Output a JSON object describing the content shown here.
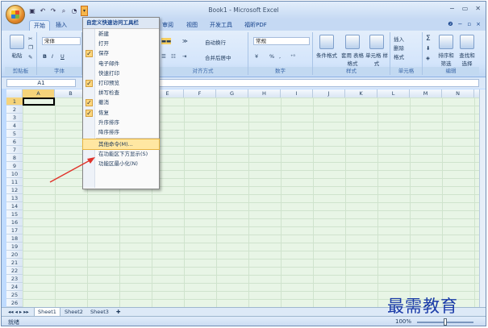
{
  "window": {
    "title": "Book1 - Microsoft Excel",
    "controls": [
      "−",
      "▭",
      "✕"
    ]
  },
  "ribbon": {
    "tabs": [
      "开始",
      "插入",
      "审阅",
      "视图",
      "开发工具",
      "福昕PDF"
    ],
    "active_tab": "开始",
    "font": {
      "name": "宋体",
      "bold": "B",
      "italic": "I",
      "underline": "U"
    },
    "alignment": {
      "wrap": "自动换行",
      "merge": "合并后居中",
      "label": "对齐方式"
    },
    "number": {
      "format": "常规",
      "percent": "%",
      "comma": ",",
      "label": "数字"
    },
    "styles": {
      "conditional": "条件格式",
      "table": "套用\n表格格式",
      "cell": "单元格\n样式",
      "label": "样式"
    },
    "cells": {
      "insert": "插入",
      "delete": "删除",
      "format": "格式",
      "label": "单元格"
    },
    "editing": {
      "sum": "Σ",
      "sort": "排序和\n筛选",
      "find": "查找和\n选择",
      "label": "编辑"
    },
    "clipboard": {
      "paste": "粘贴",
      "label": "剪贴板"
    },
    "font_group_label": "字体"
  },
  "formula_bar": {
    "name_box": "A1",
    "value": ""
  },
  "grid": {
    "columns": [
      "A",
      "B",
      "C",
      "D",
      "E",
      "F",
      "G",
      "H",
      "I",
      "J",
      "K",
      "L",
      "M",
      "N"
    ],
    "rows": [
      "1",
      "2",
      "3",
      "4",
      "5",
      "6",
      "7",
      "8",
      "9",
      "10",
      "11",
      "12",
      "13",
      "14",
      "15",
      "16",
      "17",
      "18",
      "19",
      "20",
      "21",
      "22",
      "23",
      "24",
      "25",
      "26"
    ],
    "active_cell": "A1"
  },
  "qat_menu": {
    "title": "自定义快速访问工具栏",
    "items": [
      {
        "label": "新建",
        "checked": false
      },
      {
        "label": "打开",
        "checked": false
      },
      {
        "label": "保存",
        "checked": true
      },
      {
        "label": "电子邮件",
        "checked": false
      },
      {
        "label": "快速打印",
        "checked": false
      },
      {
        "label": "打印预览",
        "checked": true
      },
      {
        "label": "拼写检查",
        "checked": false
      },
      {
        "label": "撤消",
        "checked": true
      },
      {
        "label": "恢复",
        "checked": true
      },
      {
        "label": "升序排序",
        "checked": false
      },
      {
        "label": "降序排序",
        "checked": false
      },
      {
        "label": "其他命令(M)...",
        "checked": false,
        "highlight": true
      },
      {
        "label": "在功能区下方显示(S)",
        "checked": false
      },
      {
        "label": "功能区最小化(N)",
        "checked": false
      }
    ]
  },
  "sheets": [
    "Sheet1",
    "Sheet2",
    "Sheet3"
  ],
  "active_sheet": "Sheet1",
  "status": {
    "text": "就绪",
    "zoom": "100%"
  },
  "watermark": "最需教育"
}
